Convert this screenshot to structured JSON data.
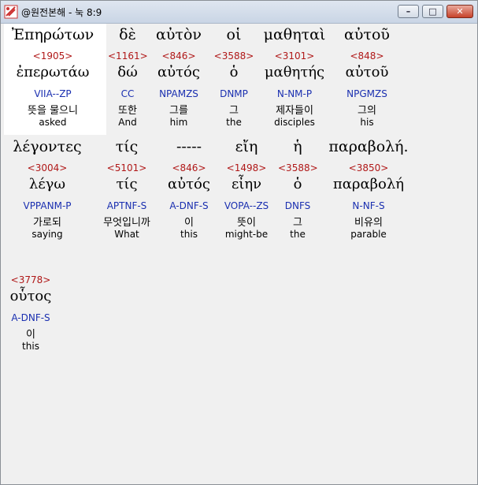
{
  "window": {
    "title": "@원전본해 - 눅 8:9"
  },
  "words": [
    {
      "greek": "Ἐπηρώτων",
      "strong": "<1905>",
      "lemma": "ἐπερωτάω",
      "parse": "VIIA--ZP",
      "korean": "뜻을 물으니",
      "english": "asked"
    },
    {
      "greek": "δὲ",
      "strong": "<1161>",
      "lemma": "δώ",
      "parse": "CC",
      "korean": "또한",
      "english": "And"
    },
    {
      "greek": "αὐτὸν",
      "strong": "<846>",
      "lemma": "αὐτός",
      "parse": "NPAMZS",
      "korean": "그를",
      "english": "him"
    },
    {
      "greek": "οἱ",
      "strong": "<3588>",
      "lemma": "ὁ",
      "parse": "DNMP",
      "korean": "그",
      "english": "the"
    },
    {
      "greek": "μαθηταὶ",
      "strong": "<3101>",
      "lemma": "μαθητής",
      "parse": "N-NM-P",
      "korean": "제자들이",
      "english": "disciples"
    },
    {
      "greek": "αὐτοῦ",
      "strong": "<848>",
      "lemma": "αὐτοῦ",
      "parse": "NPGMZS",
      "korean": "그의",
      "english": "his"
    },
    {
      "greek": "λέγοντες",
      "strong": "<3004>",
      "lemma": "λέγω",
      "parse": "VPPANM-P",
      "korean": "가로되",
      "english": "saying"
    },
    {
      "greek": "τίς",
      "strong": "<5101>",
      "lemma": "τίς",
      "parse": "APTNF-S",
      "korean": "무엇입니까",
      "english": "What"
    },
    {
      "greek": "-----",
      "strong": "<846>",
      "lemma": "αὐτός",
      "parse": "A-DNF-S",
      "korean": "이",
      "english": "this"
    },
    {
      "greek": "εἴη",
      "strong": "<1498>",
      "lemma": "εἶην",
      "parse": "VOPA--ZS",
      "korean": "뜻이",
      "english": "might-be"
    },
    {
      "greek": "ἡ",
      "strong": "<3588>",
      "lemma": "ὁ",
      "parse": "DNFS",
      "korean": "그",
      "english": "the"
    },
    {
      "greek": "παραβολή.",
      "strong": "<3850>",
      "lemma": "παραβολή",
      "parse": "N-NF-S",
      "korean": "비유의",
      "english": "parable"
    },
    {
      "greek": "",
      "strong": "<3778>",
      "lemma": "οὗτος",
      "parse": "A-DNF-S",
      "korean": "이",
      "english": "this"
    }
  ]
}
